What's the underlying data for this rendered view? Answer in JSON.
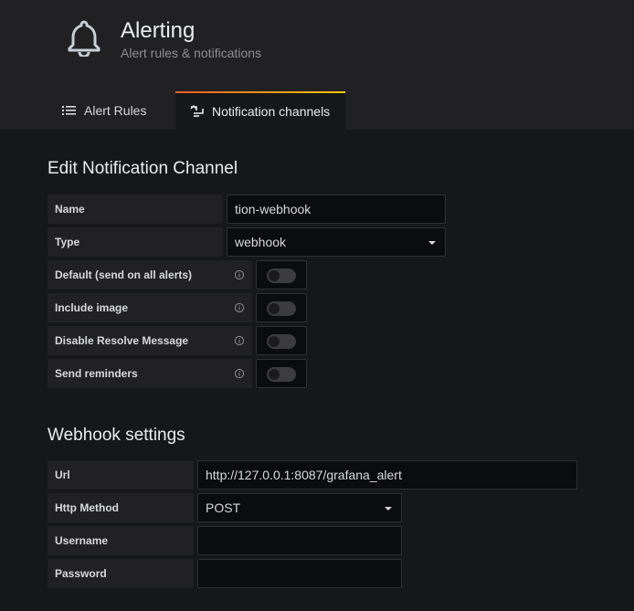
{
  "header": {
    "title": "Alerting",
    "subtitle": "Alert rules & notifications",
    "icon": "bell-icon"
  },
  "tabs": [
    {
      "label": "Alert Rules",
      "icon": "list-icon",
      "active": false
    },
    {
      "label": "Notification channels",
      "icon": "channel-icon",
      "active": true
    }
  ],
  "edit_section": {
    "title": "Edit Notification Channel",
    "name_label": "Name",
    "name_value": "tion-webhook",
    "type_label": "Type",
    "type_value": "webhook",
    "default_label": "Default (send on all alerts)",
    "default_on": false,
    "include_image_label": "Include image",
    "include_image_on": false,
    "disable_resolve_label": "Disable Resolve Message",
    "disable_resolve_on": false,
    "send_reminders_label": "Send reminders",
    "send_reminders_on": false
  },
  "webhook_section": {
    "title": "Webhook settings",
    "url_label": "Url",
    "url_value": "http://127.0.0.1:8087/grafana_alert",
    "method_label": "Http Method",
    "method_value": "POST",
    "username_label": "Username",
    "username_value": "",
    "password_label": "Password",
    "password_value": ""
  },
  "colors": {
    "background": "#161719",
    "panel": "#212124",
    "input": "#0b0c0e",
    "tab_accent_start": "#f05a28",
    "tab_accent_end": "#fbca0a"
  }
}
